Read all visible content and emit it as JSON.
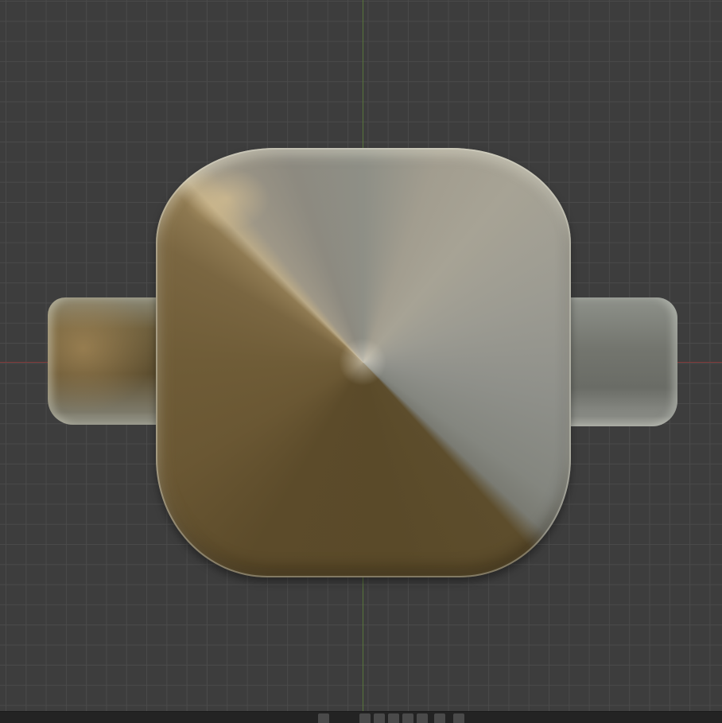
{
  "viewport": {
    "background_color": "#3d3d3d",
    "grid_color": "#4a4a4a",
    "x_axis_color": "#8a3a3a",
    "y_axis_color": "#5a7a3a",
    "object": "signet-ring-icon",
    "material_colors": {
      "gold": "#5c4b2a",
      "silver": "#9c9b92"
    }
  },
  "bottom_bar": {
    "buttons": [
      {
        "icon": "tool-button-icon"
      },
      {
        "icon": "tool-button-icon"
      },
      {
        "icon": "tool-button-icon"
      },
      {
        "icon": "tool-button-icon"
      },
      {
        "icon": "tool-button-icon"
      },
      {
        "icon": "tool-button-icon"
      },
      {
        "icon": "tool-button-icon"
      },
      {
        "icon": "tool-button-icon"
      }
    ]
  }
}
